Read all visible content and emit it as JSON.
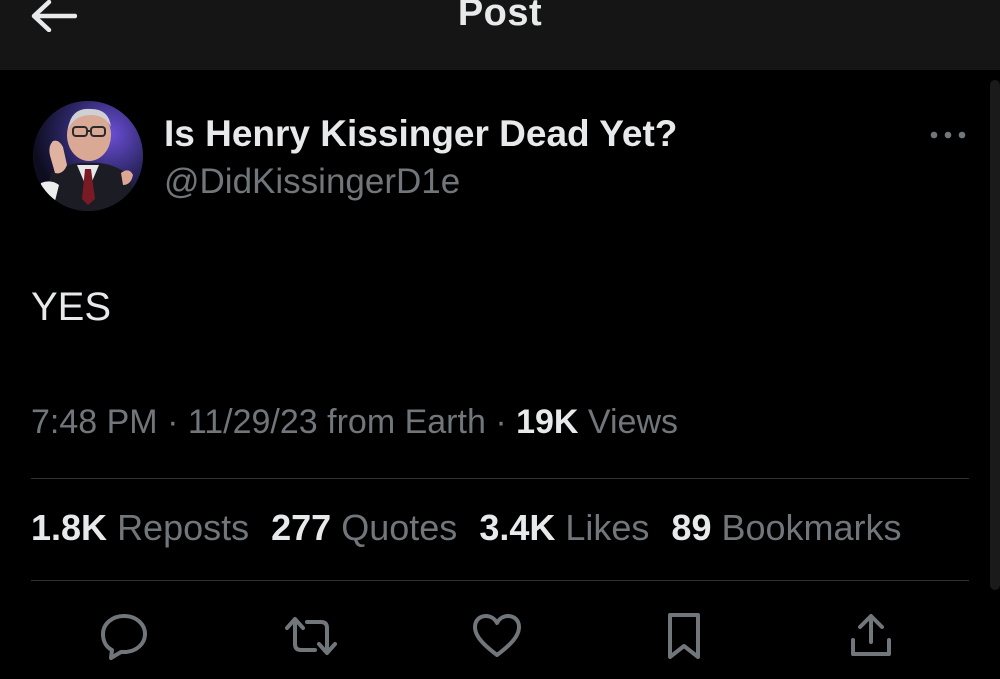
{
  "header": {
    "title": "Post"
  },
  "author": {
    "display_name": "Is Henry Kissinger Dead Yet?",
    "handle": "@DidKissingerD1e"
  },
  "post": {
    "text": "YES",
    "time": "7:48 PM",
    "date": "11/29/23",
    "source": "from Earth",
    "views_count": "19K",
    "views_label": "Views",
    "separator": "·"
  },
  "stats": [
    {
      "count": "1.8K",
      "label": "Reposts"
    },
    {
      "count": "277",
      "label": "Quotes"
    },
    {
      "count": "3.4K",
      "label": "Likes"
    },
    {
      "count": "89",
      "label": "Bookmarks"
    }
  ],
  "icons": {
    "back": "arrow-left-icon",
    "more": "more-horizontal-icon",
    "reply": "reply-icon",
    "repost": "repost-icon",
    "like": "heart-icon",
    "bookmark": "bookmark-icon",
    "share": "share-icon"
  },
  "colors": {
    "background": "#000000",
    "header_bg": "#151515",
    "text_primary": "#e7e9ea",
    "text_secondary": "#71767b",
    "divider": "#2f3336"
  }
}
